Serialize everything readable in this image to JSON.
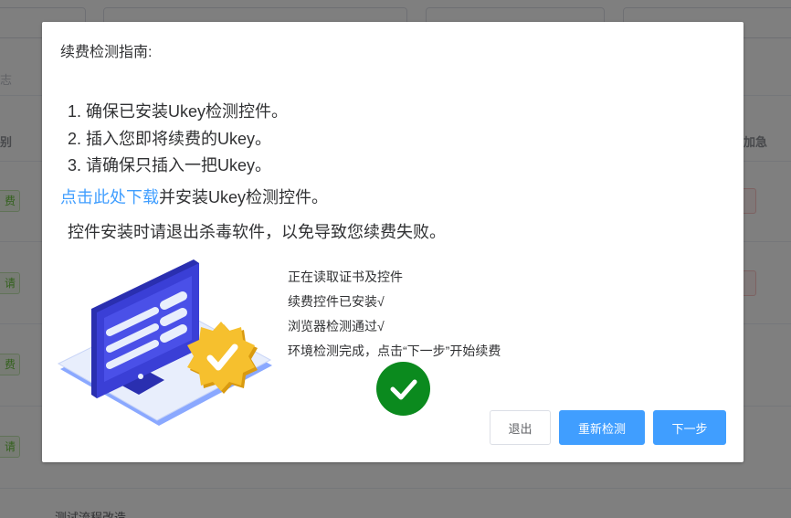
{
  "background": {
    "left_labels": [
      "志",
      "别"
    ],
    "row_tags": [
      "费",
      "请",
      "费",
      "请"
    ],
    "right_header": "加急",
    "footer_text": "测试流程改造"
  },
  "dialog": {
    "title": "续费检测指南:",
    "steps": [
      "1. 确保已安装Ukey检测控件。",
      "2. 插入您即将续费的Ukey。",
      "3. 请确保只插入一把Ukey。"
    ],
    "download_link": "点击此处下载",
    "download_suffix": "并安装Ukey检测控件。",
    "warning": "控件安装时请退出杀毒软件，以免导致您续费失败。",
    "status_lines": [
      "正在读取证书及控件",
      "续费控件已安装√",
      "浏览器检测通过√",
      "环境检测完成，点击“下一步”开始续费"
    ],
    "buttons": {
      "exit": "退出",
      "retry": "重新检测",
      "next": "下一步"
    }
  },
  "colors": {
    "primary": "#409eff",
    "success": "#0b8a1e",
    "monitor_blue": "#3a3fd6",
    "badge_yellow": "#f6c02e"
  },
  "icons": {
    "success": "check-circle-icon",
    "illustration": "monitor-certificate-icon"
  }
}
